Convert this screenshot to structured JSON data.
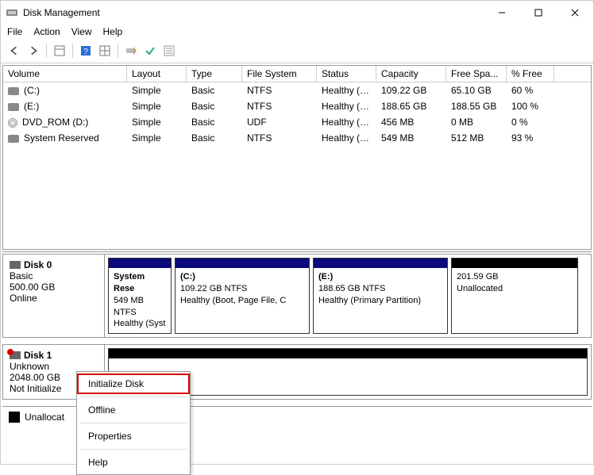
{
  "window": {
    "title": "Disk Management"
  },
  "menus": {
    "file": "File",
    "action": "Action",
    "view": "View",
    "help": "Help"
  },
  "columns": [
    "Volume",
    "Layout",
    "Type",
    "File System",
    "Status",
    "Capacity",
    "Free Spa...",
    "% Free"
  ],
  "volumes": [
    {
      "name": "(C:)",
      "layout": "Simple",
      "type": "Basic",
      "fs": "NTFS",
      "status": "Healthy (B...",
      "capacity": "109.22 GB",
      "free": "65.10 GB",
      "pct": "60 %",
      "iconKind": "disk"
    },
    {
      "name": "(E:)",
      "layout": "Simple",
      "type": "Basic",
      "fs": "NTFS",
      "status": "Healthy (P...",
      "capacity": "188.65 GB",
      "free": "188.55 GB",
      "pct": "100 %",
      "iconKind": "disk"
    },
    {
      "name": "DVD_ROM (D:)",
      "layout": "Simple",
      "type": "Basic",
      "fs": "UDF",
      "status": "Healthy (P...",
      "capacity": "456 MB",
      "free": "0 MB",
      "pct": "0 %",
      "iconKind": "cd"
    },
    {
      "name": "System Reserved",
      "layout": "Simple",
      "type": "Basic",
      "fs": "NTFS",
      "status": "Healthy (S...",
      "capacity": "549 MB",
      "free": "512 MB",
      "pct": "93 %",
      "iconKind": "disk"
    }
  ],
  "disk0": {
    "name": "Disk 0",
    "type": "Basic",
    "size": "500.00 GB",
    "state": "Online",
    "parts": [
      {
        "title": "System Rese",
        "line2": "549 MB NTFS",
        "line3": "Healthy (Syst",
        "kind": "primary"
      },
      {
        "title": "(C:)",
        "line2": "109.22 GB NTFS",
        "line3": "Healthy (Boot, Page File, C",
        "kind": "primary"
      },
      {
        "title": "(E:)",
        "line2": "188.65 GB NTFS",
        "line3": "Healthy (Primary Partition)",
        "kind": "primary"
      },
      {
        "title": "",
        "line2": "201.59 GB",
        "line3": "Unallocated",
        "kind": "unalloc"
      }
    ]
  },
  "disk1": {
    "name": "Disk 1",
    "type": "Unknown",
    "size": "2048.00 GB",
    "state": "Not Initialize"
  },
  "legend": {
    "unallocated": "Unallocat"
  },
  "contextMenu": {
    "initialize": "Initialize Disk",
    "offline": "Offline",
    "properties": "Properties",
    "help": "Help"
  }
}
